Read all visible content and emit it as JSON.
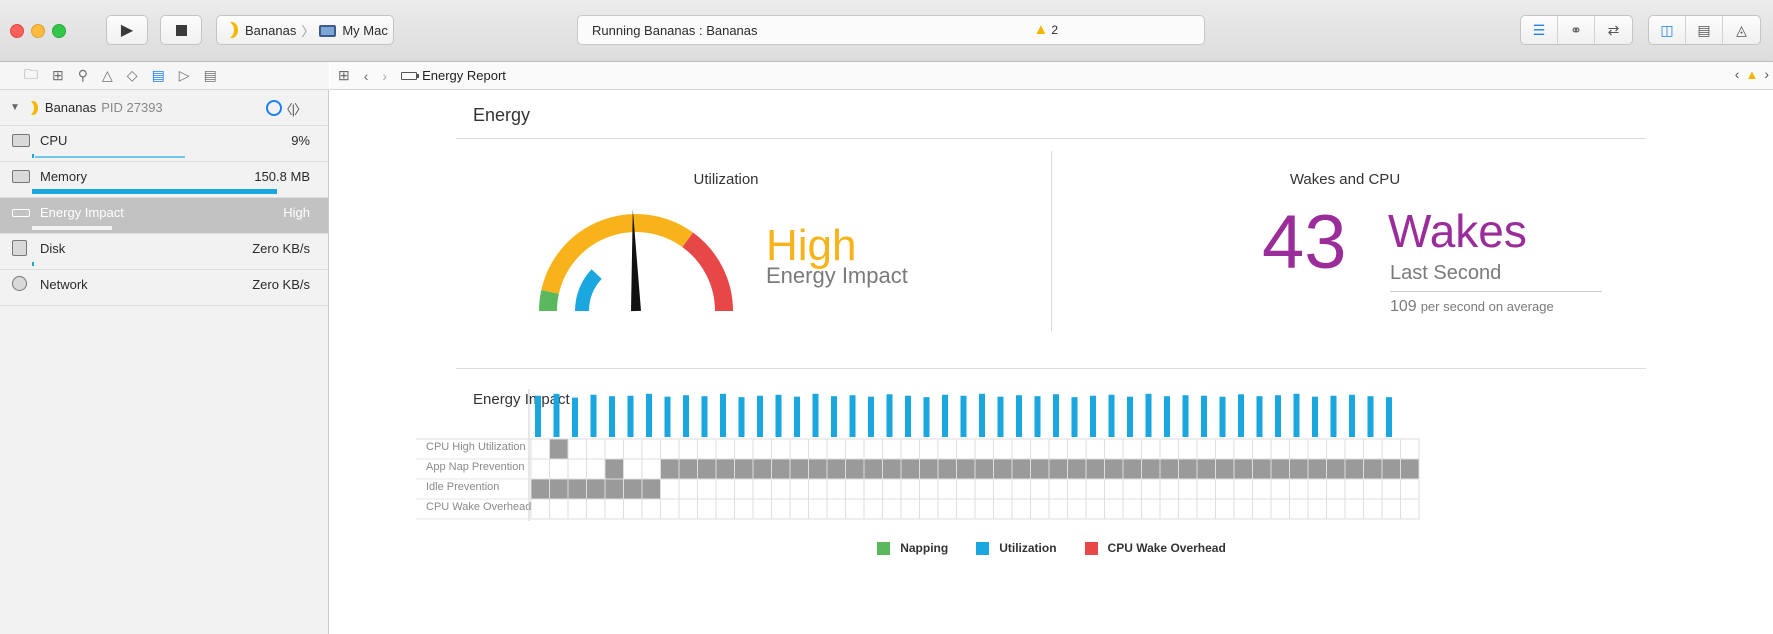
{
  "toolbar": {
    "scheme_target": "Bananas",
    "scheme_device": "My Mac",
    "status_text": "Running Bananas : Bananas",
    "warning_count": "2"
  },
  "navigator": {
    "process": {
      "name": "Bananas",
      "pid": "PID 27393"
    },
    "gauges": [
      {
        "label": "CPU",
        "value": "9%"
      },
      {
        "label": "Memory",
        "value": "150.8 MB"
      },
      {
        "label": "Energy Impact",
        "value": "High"
      },
      {
        "label": "Disk",
        "value": "Zero KB/s"
      },
      {
        "label": "Network",
        "value": "Zero KB/s"
      }
    ]
  },
  "jumpbar": {
    "crumb": "Energy Report"
  },
  "report": {
    "title": "Energy",
    "utilization": {
      "title": "Utilization",
      "level": "High",
      "level_sub": "Energy Impact",
      "needle_fraction": 0.49,
      "utilization_fraction": 0.24,
      "colors": {
        "napping": "#5cb85c",
        "utilization": "#1aa6de",
        "overhead": "#e84748",
        "high": "#f9b31a"
      }
    },
    "wakes": {
      "title": "Wakes and CPU",
      "count": "43",
      "label": "Wakes",
      "sub": "Last Second",
      "avg_value": "109",
      "avg_text": "per second on average",
      "color": "#9b2d9b"
    },
    "impact": {
      "title": "Energy Impact",
      "categories": [
        "CPU High Utilization",
        "App Nap Prevention",
        "Idle Prevention",
        "CPU Wake Overhead"
      ],
      "columns": 48,
      "bar_heights": [
        0.86,
        0.9,
        0.82,
        0.88,
        0.85,
        0.86,
        0.9,
        0.84,
        0.87,
        0.85,
        0.9,
        0.83,
        0.86,
        0.88,
        0.84,
        0.9,
        0.85,
        0.87,
        0.84,
        0.89,
        0.86,
        0.83,
        0.88,
        0.86,
        0.9,
        0.84,
        0.87,
        0.85,
        0.89,
        0.83,
        0.86,
        0.88,
        0.84,
        0.9,
        0.85,
        0.87,
        0.86,
        0.84,
        0.89,
        0.85,
        0.87,
        0.9,
        0.84,
        0.86,
        0.88,
        0.85,
        0.83,
        0
      ],
      "cpu_high_cols": [
        1
      ],
      "app_nap_cols": [
        4,
        7,
        8,
        9,
        10,
        11,
        12,
        13,
        14,
        15,
        16,
        17,
        18,
        19,
        20,
        21,
        22,
        23,
        24,
        25,
        26,
        27,
        28,
        29,
        30,
        31,
        32,
        33,
        34,
        35,
        36,
        37,
        38,
        39,
        40,
        41,
        42,
        43,
        44,
        45,
        46,
        47
      ],
      "idle_cols": [
        0,
        1,
        2,
        3,
        4,
        5,
        6
      ],
      "legend": [
        {
          "label": "Napping",
          "color": "#5cb85c"
        },
        {
          "label": "Utilization",
          "color": "#1aa6de"
        },
        {
          "label": "CPU Wake Overhead",
          "color": "#e84748"
        }
      ]
    }
  }
}
